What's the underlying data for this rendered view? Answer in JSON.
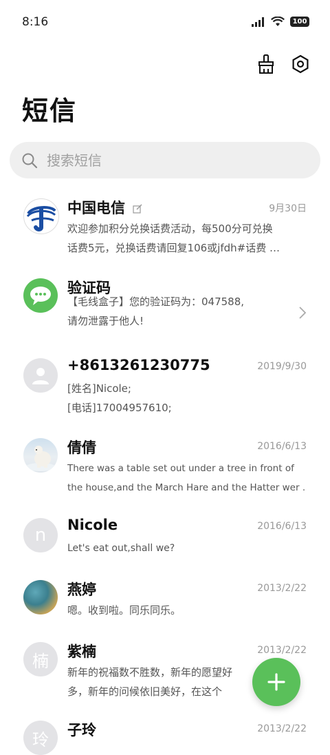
{
  "status": {
    "time": "8:16",
    "battery": "100"
  },
  "header": {
    "title": "短信"
  },
  "search": {
    "placeholder": "搜索短信"
  },
  "conversations": [
    {
      "name": "中国电信",
      "date": "9月30日",
      "line1": "欢迎参加积分兑换话费活动，每500分可兑换",
      "line2": "话费5元，兑换话费请回复106或jfdh#话费 …"
    },
    {
      "name": "验证码",
      "date": "",
      "line1": "【毛线盒子】您的验证码为：047588,",
      "line2": "请勿泄露于他人!"
    },
    {
      "name": "+8613261230775",
      "date": "2019/9/30",
      "line1": "[姓名]Nicole;",
      "line2": "[电话]17004957610;"
    },
    {
      "name": "倩倩",
      "date": "2016/6/13",
      "line1": "There was a table set out under a tree in front of",
      "line2": "the house,and the March Hare and the Hatter wer …"
    },
    {
      "name": "Nicole",
      "date": "2016/6/13",
      "line1": "Let's eat out,shall we?",
      "line2": "",
      "initial": "n"
    },
    {
      "name": "燕婷",
      "date": "2013/2/22",
      "line1": "嗯。收到啦。同乐同乐。",
      "line2": ""
    },
    {
      "name": "紫楠",
      "date": "2013/2/22",
      "line1": "新年的祝福数不胜数，新年的愿望好",
      "line2": "多，新年的问候依旧美好，在这个",
      "initial": "楠"
    },
    {
      "name": "子玲",
      "date": "2013/2/22",
      "line1": "",
      "line2": "",
      "initial": "玲"
    }
  ],
  "colors": {
    "accent": "#5ac05a",
    "telecom_blue": "#1b4ea3"
  }
}
